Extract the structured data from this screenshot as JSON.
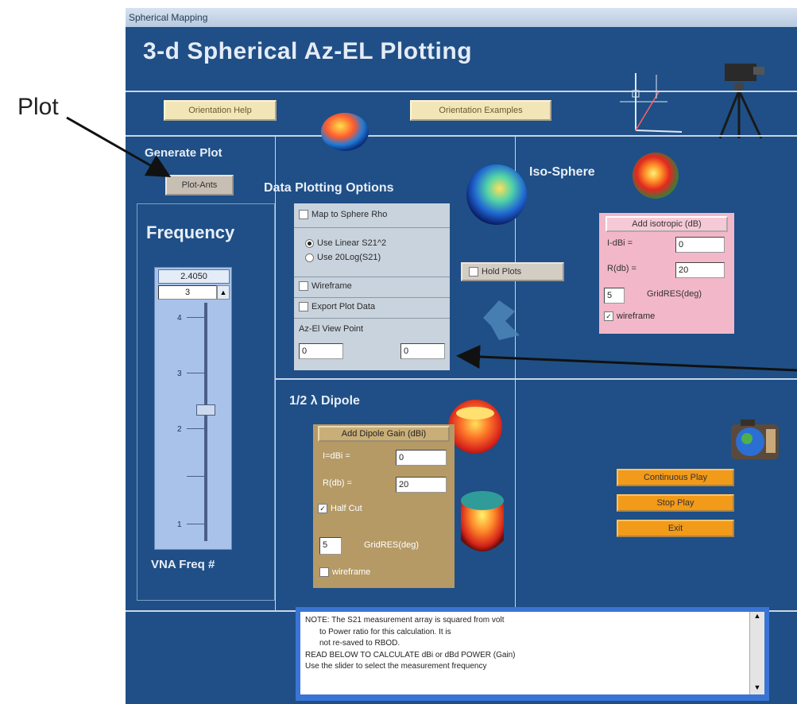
{
  "annotations": {
    "left_callout": "Plot"
  },
  "window": {
    "title": "Spherical Mapping",
    "heading": "3-d Spherical Az-EL Plotting",
    "orientation_help": "Orientation Help",
    "orientation_examples": "Orientation Examples"
  },
  "generate": {
    "label": "Generate Plot",
    "button": "Plot-Ants"
  },
  "frequency": {
    "label": "Frequency",
    "value": "2.4050",
    "index": "3",
    "ticks": [
      "4",
      "3",
      "2",
      "1"
    ],
    "footer": "VNA Freq #",
    "slider_position": 0.42
  },
  "options": {
    "title": "Data Plotting Options",
    "map_to_sphere": "Map to Sphere Rho",
    "use_linear": "Use Linear S21^2",
    "use_20log": "Use 20Log(S21)",
    "wireframe": "Wireframe",
    "export": "Export Plot Data",
    "viewpoint_label": "Az-El View Point",
    "az": "0",
    "el": "0",
    "hold_plots": "Hold Plots"
  },
  "iso": {
    "title": "Iso-Sphere",
    "button": "Add isotropic (dB)",
    "i_dbi_label": "I-dBi =",
    "i_dbi_value": "0",
    "rho_label": "R(db) =",
    "rho_value": "20",
    "grid_value": "5",
    "grid_label": "GridRES(deg)",
    "wireframe": "wireframe"
  },
  "dipole": {
    "title": "1/2 λ Dipole",
    "button": "Add Dipole Gain (dBi)",
    "i_dbi_label": "I=dBi =",
    "i_dbi_value": "0",
    "rho_label": "R(db) =",
    "rho_value": "20",
    "half_cut": "Half Cut",
    "grid_value": "5",
    "grid_label": "GridRES(deg)",
    "wireframe": "wireframe"
  },
  "actions": {
    "continuous": "Continuous Play",
    "stop": "Stop Play",
    "exit": "Exit"
  },
  "note": {
    "lines": [
      "NOTE: The S21 measurement array is squared from volt",
      "      to Power ratio for this calculation. It is",
      "      not re-saved to RBOD.",
      "READ BELOW TO CALCULATE dBi or dBd POWER (Gain)",
      "Use the slider to select the measurement frequency"
    ]
  }
}
